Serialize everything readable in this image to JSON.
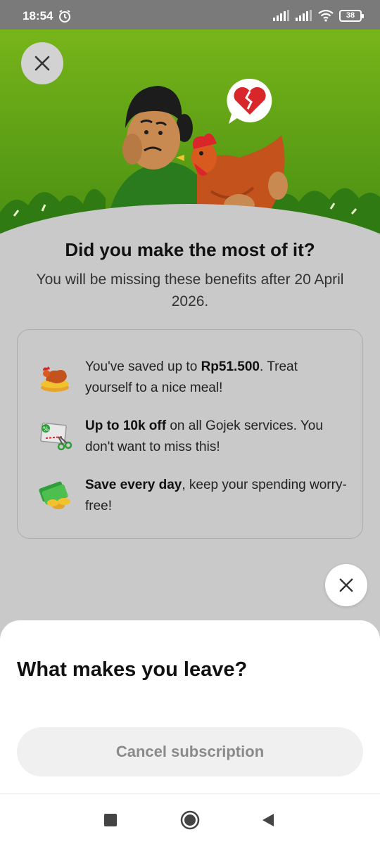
{
  "status_bar": {
    "time": "18:54",
    "battery": "38"
  },
  "colors": {
    "hero_green": "#77b51a",
    "overlay_gray": "#c9c9c9",
    "button_bg": "#f0f0f0"
  },
  "icons": [
    "close-icon",
    "alarm-icon",
    "signal-icon",
    "wifi-icon",
    "battery-icon",
    "broken-heart-icon",
    "chicken-coins-icon",
    "voucher-scissors-icon",
    "money-coins-icon",
    "square-nav-icon",
    "home-nav-icon",
    "back-nav-icon"
  ],
  "modal": {
    "headline": "Did you make the most of it?",
    "subline": "You will be missing these benefits after 20 April 2026.",
    "benefits": [
      {
        "text_before": "You've saved up to ",
        "bold": "Rp51.500",
        "text_after": ". Treat yourself to a nice meal!"
      },
      {
        "text_before": "",
        "bold": "Up to 10k off",
        "text_after": " on all Gojek services. You don't want to miss this!"
      },
      {
        "text_before": "",
        "bold": "Save every day",
        "text_after": ", keep your spending worry-free!"
      }
    ]
  },
  "sheet": {
    "title": "What makes you leave?",
    "cancel_label": "Cancel subscription"
  }
}
